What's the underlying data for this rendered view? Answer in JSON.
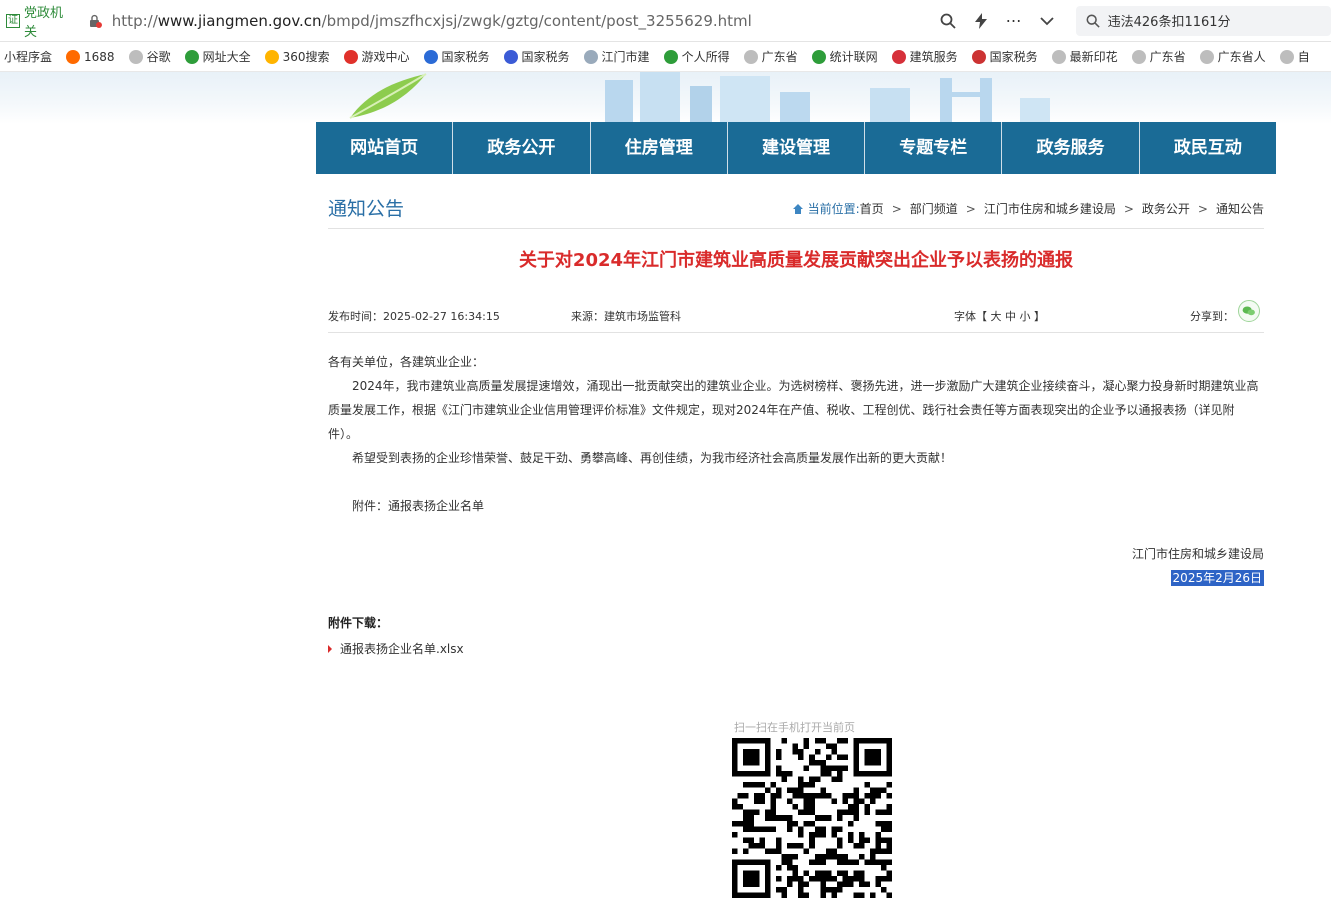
{
  "browser": {
    "badge": "党政机关",
    "badge_mark": "证",
    "url_prefix": "http://",
    "url_domain": "www.jiangmen.gov.cn",
    "url_path": "/bmpd/jmszfhcxjsj/zwgk/gztg/content/post_3255629.html",
    "search_text": "违法426条扣1161分"
  },
  "bookmarks": [
    {
      "label": "小程序盒",
      "color": "#ffffff"
    },
    {
      "label": "1688",
      "color": "#ff6a00"
    },
    {
      "label": "谷歌",
      "color": "#bdbdbd"
    },
    {
      "label": "网址大全",
      "color": "#2e9d3a"
    },
    {
      "label": "360搜索",
      "color": "#ffb400"
    },
    {
      "label": "游戏中心",
      "color": "#e0312b"
    },
    {
      "label": "国家税务",
      "color": "#2b6bd6"
    },
    {
      "label": "国家税务",
      "color": "#3b5bd6"
    },
    {
      "label": "江门市建",
      "color": "#9ab"
    },
    {
      "label": "个人所得",
      "color": "#2e9d3a"
    },
    {
      "label": "广东省",
      "color": "#bdbdbd"
    },
    {
      "label": "统计联网",
      "color": "#2e9d3a"
    },
    {
      "label": "建筑服务",
      "color": "#d6303a"
    },
    {
      "label": "国家税务",
      "color": "#c33"
    },
    {
      "label": "最新印花",
      "color": "#bdbdbd"
    },
    {
      "label": "广东省",
      "color": "#bdbdbd"
    },
    {
      "label": "广东省人",
      "color": "#bdbdbd"
    },
    {
      "label": "自",
      "color": "#bdbdbd"
    }
  ],
  "nav": [
    "网站首页",
    "政务公开",
    "住房管理",
    "建设管理",
    "专题专栏",
    "政务服务",
    "政民互动"
  ],
  "column_title": "通知公告",
  "breadcrumb": {
    "prefix": "当前位置:",
    "items": [
      "首页",
      "部门频道",
      "江门市住房和城乡建设局",
      "政务公开",
      "通知公告"
    ]
  },
  "article": {
    "title": "关于对2024年江门市建筑业高质量发展贡献突出企业予以表扬的通报",
    "date": "发布时间：2025-02-27 16:34:15",
    "source": "来源：建筑市场监管科",
    "font_size": "字体【 大  中  小 】",
    "share": "分享到：",
    "salutation": "各有关单位，各建筑业企业：",
    "para1": "2024年，我市建筑业高质量发展提速增效，涌现出一批贡献突出的建筑业企业。为选树榜样、褒扬先进，进一步激励广大建筑企业接续奋斗，凝心聚力投身新时期建筑业高质量发展工作，根据《江门市建筑业企业信用管理评价标准》文件规定，现对2024年在产值、税收、工程创优、践行社会责任等方面表现突出的企业予以通报表扬（详见附件）。",
    "para2": "希望受到表扬的企业珍惜荣誉、鼓足干劲、勇攀高峰、再创佳绩，为我市经济社会高质量发展作出新的更大贡献！",
    "attachment_line": "附件：通报表扬企业名单",
    "signer": "江门市住房和城乡建设局",
    "sign_date": "2025年2月26日"
  },
  "downloads": {
    "title": "附件下载：",
    "file": "通报表扬企业名单.xlsx"
  },
  "qr": {
    "caption": "扫一扫在手机打开当前页"
  }
}
